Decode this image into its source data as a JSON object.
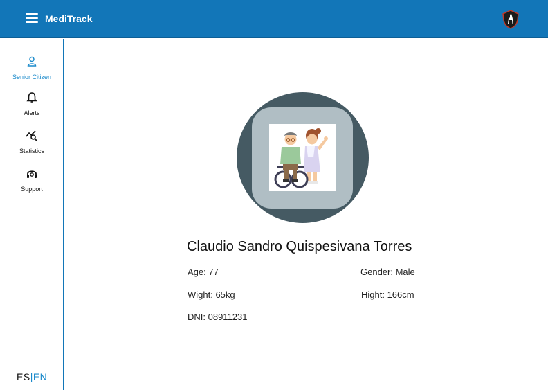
{
  "header": {
    "app_title": "MediTrack",
    "logo": "shield-llama-icon"
  },
  "sidebar": {
    "items": [
      {
        "label": "Senior Citizen",
        "icon": "person-icon",
        "active": true
      },
      {
        "label": "Alerts",
        "icon": "bell-icon",
        "active": false
      },
      {
        "label": "Statistics",
        "icon": "chart-search-icon",
        "active": false
      },
      {
        "label": "Support",
        "icon": "headset-icon",
        "active": false
      }
    ],
    "language": {
      "es": "ES",
      "separator": "|",
      "en": "EN"
    }
  },
  "profile": {
    "name": "Claudio Sandro Quispesivana Torres",
    "age": "Age: 77",
    "gender": "Gender: Male",
    "weight": "Wight: 65kg",
    "height": "Hight: 166cm",
    "dni": "DNI: 08911231"
  },
  "colors": {
    "brand": "#1276b8",
    "accent": "#1a8acb",
    "ring": "#455a63",
    "inner": "#b0bec4"
  }
}
